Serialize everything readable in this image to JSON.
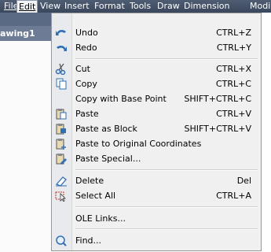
{
  "menubar": {
    "items": [
      "File",
      "Edit",
      "View",
      "Insert",
      "Format",
      "Tools",
      "Draw",
      "Dimension",
      "Modi"
    ],
    "active": "Edit"
  },
  "background": {
    "title_fragment": "awing1"
  },
  "menu": {
    "undo": {
      "label": "Undo",
      "shortcut": "CTRL+Z"
    },
    "redo": {
      "label": "Redo",
      "shortcut": "CTRL+Y"
    },
    "cut": {
      "label": "Cut",
      "shortcut": "CTRL+X"
    },
    "copy": {
      "label": "Copy",
      "shortcut": "CTRL+C"
    },
    "copy_base": {
      "label": "Copy with Base Point",
      "shortcut": "SHIFT+CTRL+C"
    },
    "paste": {
      "label": "Paste",
      "shortcut": "CTRL+V"
    },
    "paste_block": {
      "label": "Paste as Block",
      "shortcut": "SHIFT+CTRL+V"
    },
    "paste_orig": {
      "label": "Paste to Original Coordinates",
      "shortcut": ""
    },
    "paste_special": {
      "label": "Paste Special...",
      "shortcut": ""
    },
    "delete": {
      "label": "Delete",
      "shortcut": "Del"
    },
    "select_all": {
      "label": "Select All",
      "shortcut": "CTRL+A"
    },
    "ole_links": {
      "label": "OLE Links...",
      "shortcut": ""
    },
    "find": {
      "label": "Find...",
      "shortcut": ""
    }
  },
  "icons": {
    "undo": "undo-arrow-icon",
    "redo": "redo-arrow-icon",
    "cut": "scissors-icon",
    "copy": "copy-icon",
    "paste": "clipboard-icon",
    "paste_block": "paste-block-icon",
    "paste_orig": "paste-original-icon",
    "paste_special": "paste-special-icon",
    "delete": "eraser-icon",
    "select_all": "select-all-icon",
    "find": "find-icon"
  },
  "colors": {
    "menubar": "#3f4c62",
    "menu_bg": "#f0f0f0",
    "icon_blue": "#2f6fb5"
  }
}
